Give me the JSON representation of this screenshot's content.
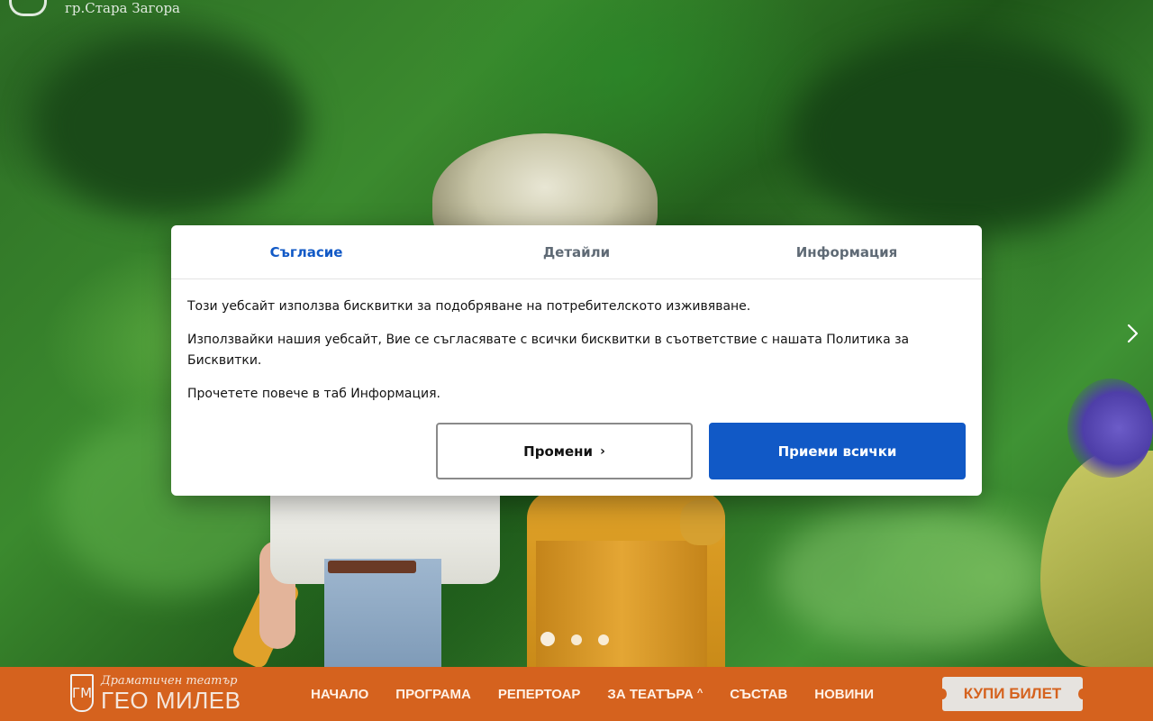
{
  "header": {
    "city": "гр.Стара Загора"
  },
  "cookie_dialog": {
    "tabs": [
      {
        "label": "Съгласие",
        "active": true
      },
      {
        "label": "Детайли",
        "active": false
      },
      {
        "label": "Информация",
        "active": false
      }
    ],
    "paragraphs": [
      "Този уебсайт използва бисквитки за подобряване на потребителското изживяване.",
      "Използвайки нашия уебсайт, Вие се съгласявате с всички бисквитки в съответствие с нашата Политика за Бисквитки.",
      "Прочетете повече в таб Информация."
    ],
    "change_button": "Промени",
    "change_chevron": "›",
    "accept_all_button": "Приеми всички"
  },
  "slider": {
    "dots_count": 3,
    "active_index": 0
  },
  "nav": {
    "logo_subtitle": "Драматичен театър",
    "logo_name": "ГЕО МИЛЕВ",
    "links": [
      {
        "label": "НАЧАЛО"
      },
      {
        "label": "ПРОГРАМА"
      },
      {
        "label": "РЕПЕРТОАР"
      },
      {
        "label": "ЗА ТЕАТЪРА",
        "caret": "^"
      },
      {
        "label": "СЪСТАВ"
      },
      {
        "label": "НОВИНИ"
      }
    ],
    "buy_ticket": "КУПИ БИЛЕТ"
  },
  "colors": {
    "accent_blue": "#1159c6",
    "nav_orange": "#d5621e",
    "ticket_bg": "#e6e3df"
  }
}
